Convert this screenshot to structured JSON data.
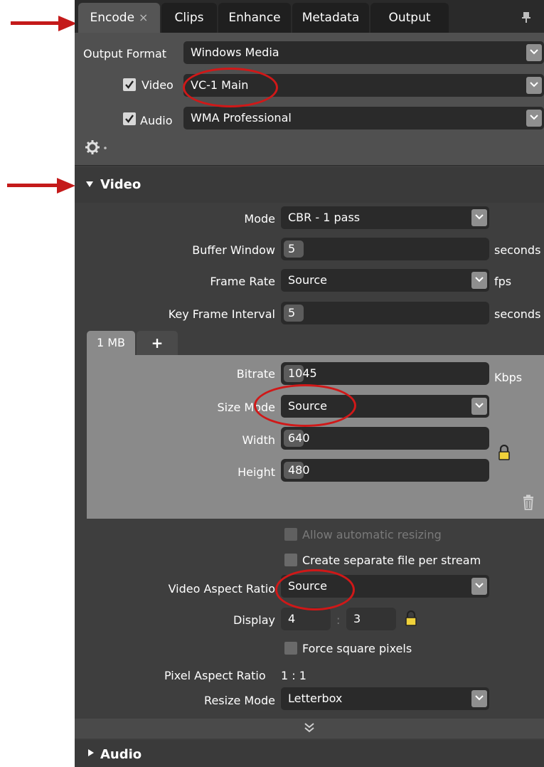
{
  "tabs": [
    {
      "label": "Encode",
      "close": "×",
      "active": true
    },
    {
      "label": "Clips",
      "active": false
    },
    {
      "label": "Enhance",
      "active": false
    },
    {
      "label": "Metadata",
      "active": false
    },
    {
      "label": "Output",
      "active": false
    }
  ],
  "header": {
    "output_format_label": "Output Format",
    "output_format_value": "Windows Media",
    "video_label": "Video",
    "video_value": "VC-1 Main",
    "video_checked": true,
    "audio_label": "Audio",
    "audio_value": "WMA Professional",
    "audio_checked": true
  },
  "video_section": {
    "title": "Video",
    "mode_label": "Mode",
    "mode_value": "CBR - 1 pass",
    "buffer_window_label": "Buffer Window",
    "buffer_window_value": "5",
    "buffer_window_unit": "seconds",
    "frame_rate_label": "Frame Rate",
    "frame_rate_value": "Source",
    "frame_rate_unit": "fps",
    "key_frame_label": "Key Frame Interval",
    "key_frame_value": "5",
    "key_frame_unit": "seconds"
  },
  "stream": {
    "tab_label": "1 MB",
    "add_label": "+",
    "bitrate_label": "Bitrate",
    "bitrate_value": "1045",
    "bitrate_unit": "Kbps",
    "size_mode_label": "Size Mode",
    "size_mode_value": "Source",
    "width_label": "Width",
    "width_value": "640",
    "height_label": "Height",
    "height_value": "480"
  },
  "options": {
    "allow_resizing_label": "Allow automatic resizing",
    "allow_resizing_checked": false,
    "separate_file_label": "Create separate file per stream",
    "separate_file_checked": false,
    "aspect_ratio_label": "Video Aspect Ratio",
    "aspect_ratio_value": "Source",
    "display_label": "Display",
    "display_w": "4",
    "display_sep": ":",
    "display_h": "3",
    "force_square_label": "Force square pixels",
    "force_square_checked": false,
    "pixel_aspect_label": "Pixel Aspect Ratio",
    "pixel_aspect_value": "1 : 1",
    "resize_mode_label": "Resize Mode",
    "resize_mode_value": "Letterbox"
  },
  "audio_section": {
    "title": "Audio"
  },
  "colors": {
    "panel": "#3e3e3e",
    "annotation": "#c41a1a",
    "field": "#2a2a2a"
  }
}
